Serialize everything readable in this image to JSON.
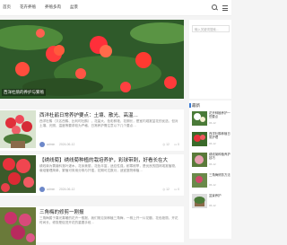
{
  "nav": {
    "items": [
      "首页",
      "花卉养殖",
      "养殖多肉",
      "盆景"
    ]
  },
  "hero": {
    "caption": "西洋杜鹃的养护与繁殖"
  },
  "articles": [
    {
      "title": "西洋杜鹃日常养护要点：土壤、散光、高温…",
      "excerpt": "西洋杜鹃（又名西鹃、比利时杜鹃），花量大、色彩鲜艳、花期长，是室内观赏盆花的优选，但对土壤、光照、温度等要求较为严格，日常养护需注意以下几个要点…",
      "author": "admin",
      "date": "2024-06-12",
      "views": "12",
      "comments": "0"
    },
    {
      "title": "【绣线菊】绣线菊种植的栽培养护，彩球带刺，好看长在大",
      "excerpt": "绣线菊为蔷薇科落叶灌木，花序美丽，花色丰富，适应性强，耐寒耐旱，是优良的园林观赏植物，栽培管理简单，繁殖可采用分株与扦插，花期可达数月，适宜庭院种植…",
      "author": "admin",
      "date": "2024-06-12",
      "views": "12",
      "comments": "0"
    },
    {
      "title": "三角梅的修剪一刚报",
      "excerpt": "三角梅属于喜光喜暖的花卉一般报，我们常见到种植三角梅，一株上开一片花瓣，花色艳丽，开花时间长，修剪是促进开花的重要手段…",
      "author": "admin",
      "date": "2024-06-12",
      "views": "12",
      "comments": "0"
    }
  ],
  "sidebar": {
    "search_placeholder": "输入关键词搜索...",
    "recent_title": "最新",
    "recent": [
      {
        "title": "花卉种植养护一些要点",
        "date": "06-12"
      },
      {
        "title": "西洋杜鹃种植日常护理",
        "date": "06-12"
      },
      {
        "title": "绣线菊种植养护技巧",
        "date": "06-12"
      },
      {
        "title": "三角梅修剪方法",
        "date": "06-12"
      },
      {
        "title": "盆景养护",
        "date": "06-12"
      }
    ]
  },
  "colors": {
    "accent": "#3a7bd5",
    "background": "#f4f4f4"
  },
  "icons": [
    "search-icon",
    "menu-icon",
    "eye-icon",
    "comment-icon"
  ]
}
